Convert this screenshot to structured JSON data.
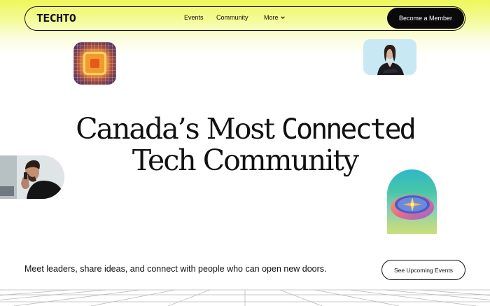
{
  "nav": {
    "logo": "TECHTO",
    "links": [
      {
        "label": "Events"
      },
      {
        "label": "Community"
      },
      {
        "label": "More"
      }
    ],
    "cta_label": "Become a Member"
  },
  "hero": {
    "line1_a": "Canada’s Most ",
    "line1_b": "Connected",
    "line2": "Tech Community"
  },
  "tagline": "Meet leaders, share ideas, and connect with people who can open new doors.",
  "secondary_cta": "See Upcoming Events",
  "colors": {
    "accent": "#eef75a",
    "button_bg": "#0a0a0a",
    "text": "#111111"
  },
  "icons": {
    "more_chevron": "chevron-down-icon"
  }
}
